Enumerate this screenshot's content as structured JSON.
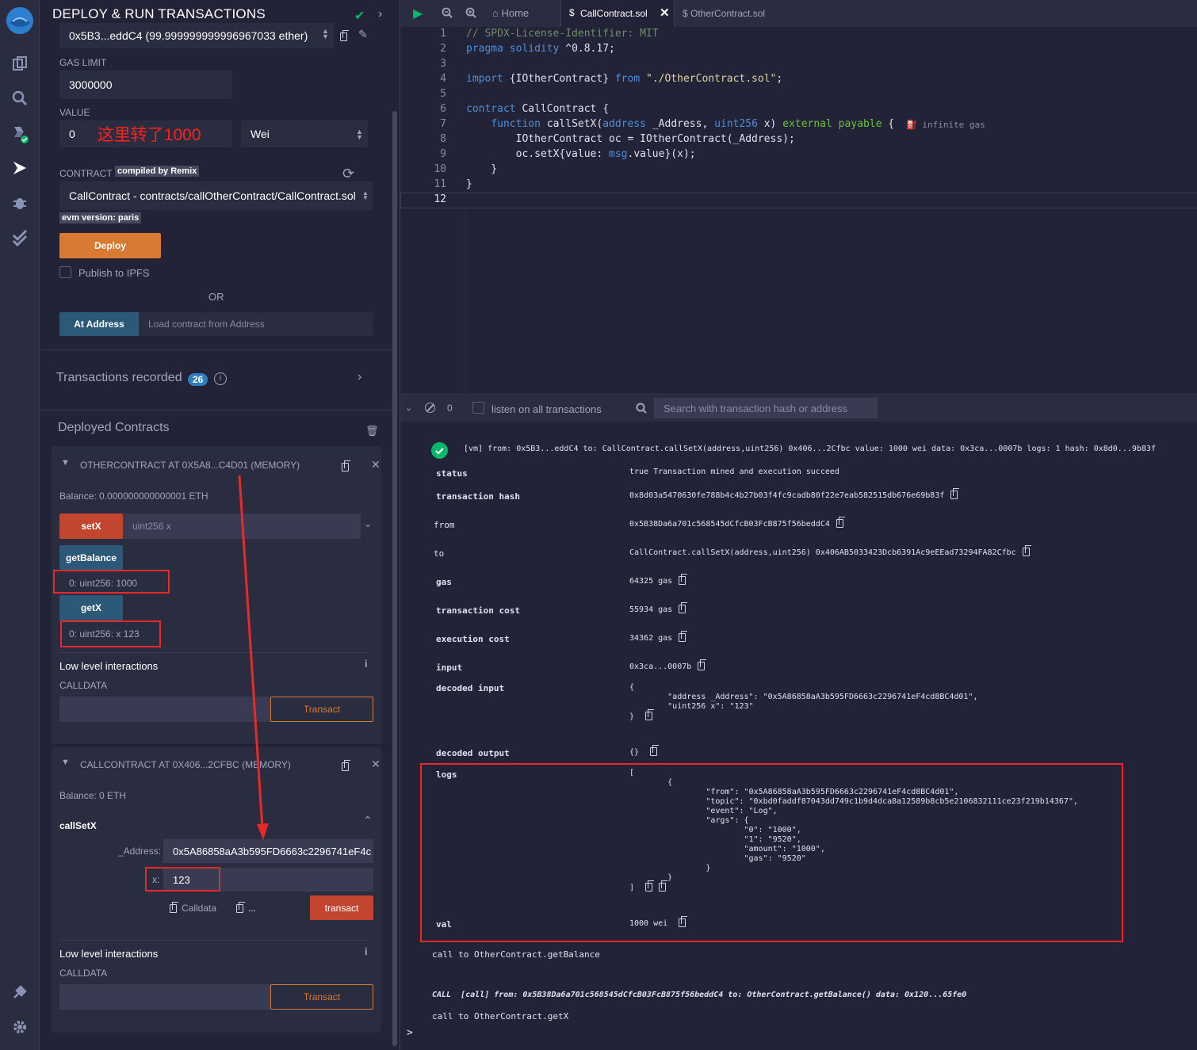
{
  "app": {
    "panel_title": "DEPLOY & RUN TRANSACTIONS"
  },
  "account": {
    "value": "0x5B3...eddC4 (99.999999999996967033 ether)"
  },
  "gas_limit": {
    "label": "GAS LIMIT",
    "value": "3000000"
  },
  "value_field": {
    "label": "VALUE",
    "value": "0",
    "annotation": "这里转了1000",
    "unit": "Wei"
  },
  "contract": {
    "label": "CONTRACT",
    "badge": "compiled by Remix",
    "selected": "CallContract - contracts/callOtherContract/CallContract.sol",
    "evm_badge": "evm version: paris"
  },
  "deploy": {
    "label": "Deploy",
    "ipfs_label": "Publish to IPFS",
    "or": "OR",
    "at_address": "At Address",
    "at_address_placeholder": "Load contract from Address"
  },
  "transactions": {
    "label": "Transactions recorded",
    "count": "26"
  },
  "deployed": {
    "title": "Deployed Contracts",
    "other": {
      "title": "OTHERCONTRACT AT 0X5A8...C4D01 (MEMORY)",
      "balance": "Balance: 0.000000000000001 ETH",
      "setx": "setX",
      "setx_placeholder": "uint256 x",
      "getbalance": "getBalance",
      "getbalance_out": "0: uint256: 1000",
      "getx": "getX",
      "getx_out": "0: uint256: x 123",
      "low_level": "Low level interactions",
      "calldata": "CALLDATA",
      "transact": "Transact"
    },
    "call": {
      "title": "CALLCONTRACT AT 0X406...2CFBC (MEMORY)",
      "balance": "Balance: 0 ETH",
      "func": "callSetX",
      "addr_label": "_Address:",
      "addr_value": "0x5A86858aA3b595FD6663c2296741eF4c",
      "x_label": "x:",
      "x_value": "123",
      "calldata_btn": "Calldata",
      "dots": "...",
      "transact": "transact",
      "low_level": "Low level interactions",
      "calldata": "CALLDATA",
      "transact2": "Transact"
    }
  },
  "tabs": {
    "home": "Home",
    "active": "CallContract.sol",
    "other": "OtherContract.sol"
  },
  "code": {
    "lines": [
      "1",
      "2",
      "3",
      "4",
      "5",
      "6",
      "7",
      "8",
      "9",
      "10",
      "11",
      "12"
    ],
    "gas_hint": "infinite gas"
  },
  "terminal": {
    "count": "0",
    "listen": "listen on all transactions",
    "search_placeholder": "Search with transaction hash or address",
    "tx_line": "[vm] from: 0x5B3...eddC4 to: CallContract.callSetX(address,uint256) 0x406...2Cfbc value: 1000 wei data: 0x3ca...0007b logs: 1 hash: 0x8d0...9b83f",
    "rows": [
      {
        "k": "status",
        "v": "true Transaction mined and execution succeed"
      },
      {
        "k": "transaction hash",
        "v": "0x8d03a5470630fe788b4c4b27b03f4fc9cadb80f22e7eab582515db676e69b83f"
      },
      {
        "k": "from",
        "v": "0x5B38Da6a701c568545dCfcB03FcB875f56beddC4"
      },
      {
        "k": "to",
        "v": "CallContract.callSetX(address,uint256) 0x406AB5033423Dcb6391Ac9eEEad73294FA82Cfbc"
      },
      {
        "k": "gas",
        "v": "64325 gas"
      },
      {
        "k": "transaction cost",
        "v": "55934 gas"
      },
      {
        "k": "execution cost",
        "v": "34362 gas"
      },
      {
        "k": "input",
        "v": "0x3ca...0007b"
      }
    ],
    "decoded_input_k": "decoded input",
    "decoded_input": "{\n        \"address _Address\": \"0x5A86858aA3b595FD6663c2296741eF4cd8BC4d01\",\n        \"uint256 x\": \"123\"\n}",
    "decoded_output_k": "decoded output",
    "decoded_output": "{}",
    "logs_k": "logs",
    "logs": "[\n        {\n                \"from\": \"0x5A86858aA3b595FD6663c2296741eF4cd8BC4d01\",\n                \"topic\": \"0xbd0faddf87043dd749c1b9d4dca8a12589b8cb5e2106832111ce23f219b14367\",\n                \"event\": \"Log\",\n                \"args\": {\n                        \"0\": \"1000\",\n                        \"1\": \"9520\",\n                        \"amount\": \"1000\",\n                        \"gas\": \"9520\"\n                }\n        }\n]",
    "val_k": "val",
    "val": "1000 wei",
    "call1": "call to OtherContract.getBalance",
    "call_line": "CALL  [call] from: 0x5B38Da6a701c568545dCfcB03FcB875f56beddC4 to: OtherContract.getBalance() data: 0x120...65fe0",
    "call2": "call to OtherContract.getX",
    "prompt": ">"
  }
}
